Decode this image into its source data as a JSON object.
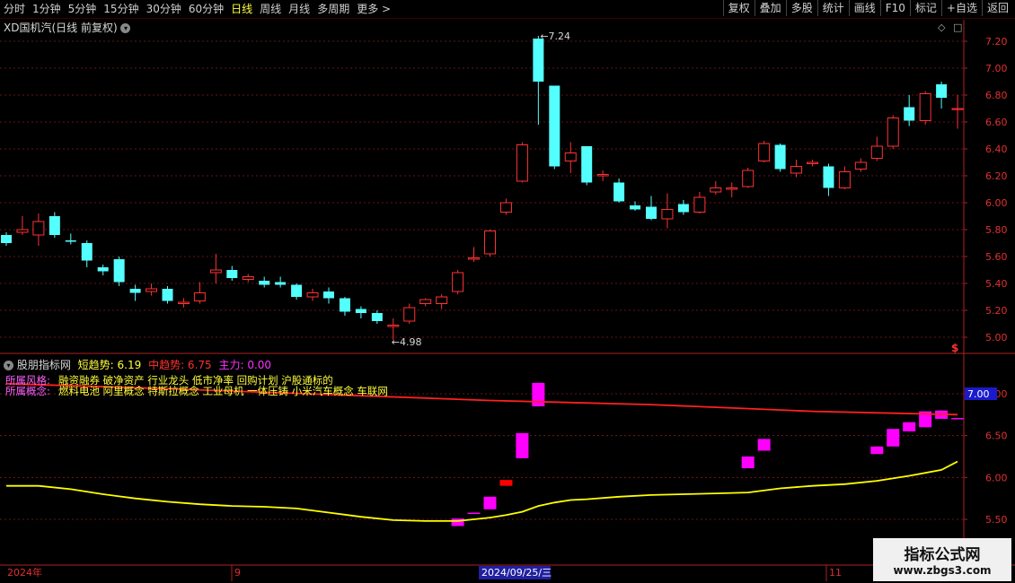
{
  "toolbar": {
    "periods": [
      "分时",
      "1分钟",
      "5分钟",
      "15分钟",
      "30分钟",
      "60分钟",
      "日线",
      "周线",
      "月线",
      "多周期",
      "更多 >"
    ],
    "active_period": "日线",
    "right_buttons": [
      "复权",
      "叠加",
      "多股",
      "统计",
      "画线",
      "F10",
      "标记",
      "+自选",
      "返回"
    ]
  },
  "stock": {
    "title": "XD国机汽(日线 前复权)"
  },
  "indicator": {
    "name": "股朋指标网",
    "short_label": "短趋势: 6.19",
    "mid_label": "中趋势: 6.75",
    "main_label": "主力: 0.00",
    "current_value_tag": "7.00",
    "style_label": "所属风格:",
    "style_text": "融资融券 破净资产 行业龙头 低市净率 回购计划 沪股通标的",
    "concept_label": "所属概念:",
    "concept_text": "燃料电池 阿里概念 特斯拉概念 工业母机 一体压铸 小米汽车概念 车联网"
  },
  "watermark": {
    "line1": "指标公式网",
    "line2": "www.zbgs3.com"
  },
  "colors": {
    "up": "#ff3232",
    "down": "#54ffff",
    "bg": "#000000",
    "grid": "#8b1a1a",
    "short": "#ffff00",
    "mid": "#ff2020",
    "main": "#ff00ff"
  },
  "chart_data": [
    {
      "type": "candlestick",
      "title": "XD国机汽(日线 前复权)",
      "ylim": [
        4.9,
        7.3
      ],
      "y_ticks": [
        "7.20",
        "7.00",
        "6.80",
        "6.60",
        "6.40",
        "6.20",
        "6.00",
        "5.80",
        "5.60",
        "5.40",
        "5.20",
        "5.00"
      ],
      "x_labels": [
        "2024年",
        "9",
        "2024/09/25/三",
        "11"
      ],
      "annotations": [
        "7.24",
        "4.98"
      ],
      "candles": [
        {
          "o": 5.76,
          "c": 5.7,
          "h": 5.78,
          "l": 5.68
        },
        {
          "o": 5.78,
          "c": 5.8,
          "h": 5.9,
          "l": 5.76
        },
        {
          "o": 5.76,
          "c": 5.86,
          "h": 5.92,
          "l": 5.68
        },
        {
          "o": 5.9,
          "c": 5.76,
          "h": 5.93,
          "l": 5.74
        },
        {
          "o": 5.72,
          "c": 5.71,
          "h": 5.77,
          "l": 5.69
        },
        {
          "o": 5.7,
          "c": 5.57,
          "h": 5.72,
          "l": 5.52
        },
        {
          "o": 5.52,
          "c": 5.49,
          "h": 5.54,
          "l": 5.46
        },
        {
          "o": 5.58,
          "c": 5.41,
          "h": 5.6,
          "l": 5.38
        },
        {
          "o": 5.36,
          "c": 5.33,
          "h": 5.39,
          "l": 5.27
        },
        {
          "o": 5.34,
          "c": 5.36,
          "h": 5.4,
          "l": 5.31
        },
        {
          "o": 5.36,
          "c": 5.27,
          "h": 5.38,
          "l": 5.25
        },
        {
          "o": 5.25,
          "c": 5.26,
          "h": 5.29,
          "l": 5.22
        },
        {
          "o": 5.27,
          "c": 5.33,
          "h": 5.41,
          "l": 5.25
        },
        {
          "o": 5.48,
          "c": 5.5,
          "h": 5.62,
          "l": 5.4
        },
        {
          "o": 5.5,
          "c": 5.44,
          "h": 5.53,
          "l": 5.42
        },
        {
          "o": 5.43,
          "c": 5.45,
          "h": 5.47,
          "l": 5.41
        },
        {
          "o": 5.42,
          "c": 5.39,
          "h": 5.45,
          "l": 5.37
        },
        {
          "o": 5.41,
          "c": 5.39,
          "h": 5.45,
          "l": 5.37
        },
        {
          "o": 5.39,
          "c": 5.3,
          "h": 5.4,
          "l": 5.28
        },
        {
          "o": 5.3,
          "c": 5.33,
          "h": 5.36,
          "l": 5.27
        },
        {
          "o": 5.34,
          "c": 5.29,
          "h": 5.37,
          "l": 5.25
        },
        {
          "o": 5.29,
          "c": 5.19,
          "h": 5.3,
          "l": 5.16
        },
        {
          "o": 5.21,
          "c": 5.18,
          "h": 5.23,
          "l": 5.14
        },
        {
          "o": 5.18,
          "c": 5.12,
          "h": 5.2,
          "l": 5.1
        },
        {
          "o": 5.08,
          "c": 5.09,
          "h": 5.14,
          "l": 4.98
        },
        {
          "o": 5.12,
          "c": 5.22,
          "h": 5.25,
          "l": 5.1
        },
        {
          "o": 5.25,
          "c": 5.28,
          "h": 5.29,
          "l": 5.23
        },
        {
          "o": 5.25,
          "c": 5.3,
          "h": 5.32,
          "l": 5.21
        },
        {
          "o": 5.34,
          "c": 5.48,
          "h": 5.5,
          "l": 5.32
        },
        {
          "o": 5.58,
          "c": 5.59,
          "h": 5.67,
          "l": 5.56
        },
        {
          "o": 5.62,
          "c": 5.79,
          "h": 5.8,
          "l": 5.6
        },
        {
          "o": 5.93,
          "c": 6.0,
          "h": 6.03,
          "l": 5.91
        },
        {
          "o": 6.16,
          "c": 6.43,
          "h": 6.45,
          "l": 6.15
        },
        {
          "o": 7.22,
          "c": 6.9,
          "h": 7.24,
          "l": 6.58
        },
        {
          "o": 6.87,
          "c": 6.27,
          "h": 6.87,
          "l": 6.25
        },
        {
          "o": 6.31,
          "c": 6.37,
          "h": 6.45,
          "l": 6.22
        },
        {
          "o": 6.42,
          "c": 6.15,
          "h": 6.42,
          "l": 6.13
        },
        {
          "o": 6.2,
          "c": 6.21,
          "h": 6.24,
          "l": 6.16
        },
        {
          "o": 6.15,
          "c": 6.01,
          "h": 6.18,
          "l": 6.0
        },
        {
          "o": 5.98,
          "c": 5.95,
          "h": 6.01,
          "l": 5.94
        },
        {
          "o": 5.97,
          "c": 5.88,
          "h": 6.05,
          "l": 5.87
        },
        {
          "o": 5.88,
          "c": 5.95,
          "h": 6.07,
          "l": 5.81
        },
        {
          "o": 5.99,
          "c": 5.93,
          "h": 6.02,
          "l": 5.91
        },
        {
          "o": 5.93,
          "c": 6.04,
          "h": 6.08,
          "l": 5.92
        },
        {
          "o": 6.08,
          "c": 6.11,
          "h": 6.16,
          "l": 6.06
        },
        {
          "o": 6.1,
          "c": 6.11,
          "h": 6.15,
          "l": 6.04
        },
        {
          "o": 6.12,
          "c": 6.24,
          "h": 6.26,
          "l": 6.11
        },
        {
          "o": 6.31,
          "c": 6.44,
          "h": 6.46,
          "l": 6.3
        },
        {
          "o": 6.43,
          "c": 6.25,
          "h": 6.44,
          "l": 6.23
        },
        {
          "o": 6.22,
          "c": 6.27,
          "h": 6.32,
          "l": 6.19
        },
        {
          "o": 6.29,
          "c": 6.3,
          "h": 6.32,
          "l": 6.27
        },
        {
          "o": 6.27,
          "c": 6.11,
          "h": 6.29,
          "l": 6.05
        },
        {
          "o": 6.11,
          "c": 6.23,
          "h": 6.27,
          "l": 6.1
        },
        {
          "o": 6.25,
          "c": 6.3,
          "h": 6.33,
          "l": 6.23
        },
        {
          "o": 6.33,
          "c": 6.42,
          "h": 6.49,
          "l": 6.31
        },
        {
          "o": 6.42,
          "c": 6.63,
          "h": 6.65,
          "l": 6.4
        },
        {
          "o": 6.71,
          "c": 6.61,
          "h": 6.8,
          "l": 6.57
        },
        {
          "o": 6.61,
          "c": 6.81,
          "h": 6.83,
          "l": 6.58
        },
        {
          "o": 6.88,
          "c": 6.78,
          "h": 6.9,
          "l": 6.7
        },
        {
          "o": 6.7,
          "c": 6.7,
          "h": 6.8,
          "l": 6.55
        }
      ]
    },
    {
      "type": "line",
      "title": "股朋指标网",
      "ylim": [
        5.4,
        7.2
      ],
      "y_ticks": [
        "7.00",
        "6.50",
        "6.00",
        "5.50"
      ],
      "series": [
        {
          "name": "短趋势",
          "x": [
            0,
            2,
            4,
            6,
            8,
            10,
            12,
            14,
            16,
            18,
            20,
            22,
            24,
            26,
            28,
            30,
            31,
            32,
            33,
            34,
            35,
            36,
            38,
            40,
            42,
            44,
            46,
            48,
            50,
            52,
            54,
            56,
            58,
            59
          ],
          "values": [
            5.9,
            5.9,
            5.86,
            5.8,
            5.75,
            5.71,
            5.68,
            5.66,
            5.65,
            5.63,
            5.58,
            5.53,
            5.49,
            5.48,
            5.48,
            5.52,
            5.55,
            5.59,
            5.66,
            5.7,
            5.73,
            5.74,
            5.77,
            5.79,
            5.8,
            5.81,
            5.82,
            5.87,
            5.9,
            5.92,
            5.96,
            6.02,
            6.09,
            6.19
          ]
        },
        {
          "name": "中趋势",
          "x": [
            0,
            10,
            20,
            30,
            40,
            50,
            59
          ],
          "values": [
            7.12,
            7.06,
            6.99,
            6.92,
            6.87,
            6.79,
            6.75
          ]
        },
        {
          "name": "主力",
          "values": [
            0.0
          ]
        }
      ],
      "signal_bars": [
        {
          "i": 28,
          "lo": 5.42,
          "hi": 5.51,
          "color": "#ff00ff"
        },
        {
          "i": 29,
          "lo": 5.57,
          "hi": 5.58,
          "color": "#ff00ff"
        },
        {
          "i": 30,
          "lo": 5.62,
          "hi": 5.77,
          "color": "#ff00ff"
        },
        {
          "i": 31,
          "lo": 5.9,
          "hi": 5.97,
          "color": "#ff0000"
        },
        {
          "i": 32,
          "lo": 6.23,
          "hi": 6.53,
          "color": "#ff00ff"
        },
        {
          "i": 33,
          "lo": 6.85,
          "hi": 7.13,
          "color": "#ff00ff"
        },
        {
          "i": 46,
          "lo": 6.11,
          "hi": 6.25,
          "color": "#ff00ff"
        },
        {
          "i": 47,
          "lo": 6.32,
          "hi": 6.46,
          "color": "#ff00ff"
        },
        {
          "i": 54,
          "lo": 6.28,
          "hi": 6.37,
          "color": "#ff00ff"
        },
        {
          "i": 55,
          "lo": 6.37,
          "hi": 6.58,
          "color": "#ff00ff"
        },
        {
          "i": 56,
          "lo": 6.55,
          "hi": 6.66,
          "color": "#ff00ff"
        },
        {
          "i": 57,
          "lo": 6.6,
          "hi": 6.79,
          "color": "#ff00ff"
        },
        {
          "i": 58,
          "lo": 6.7,
          "hi": 6.8,
          "color": "#ff00ff"
        },
        {
          "i": 59,
          "lo": 6.7,
          "hi": 6.71,
          "color": "#ff00ff"
        }
      ]
    }
  ]
}
